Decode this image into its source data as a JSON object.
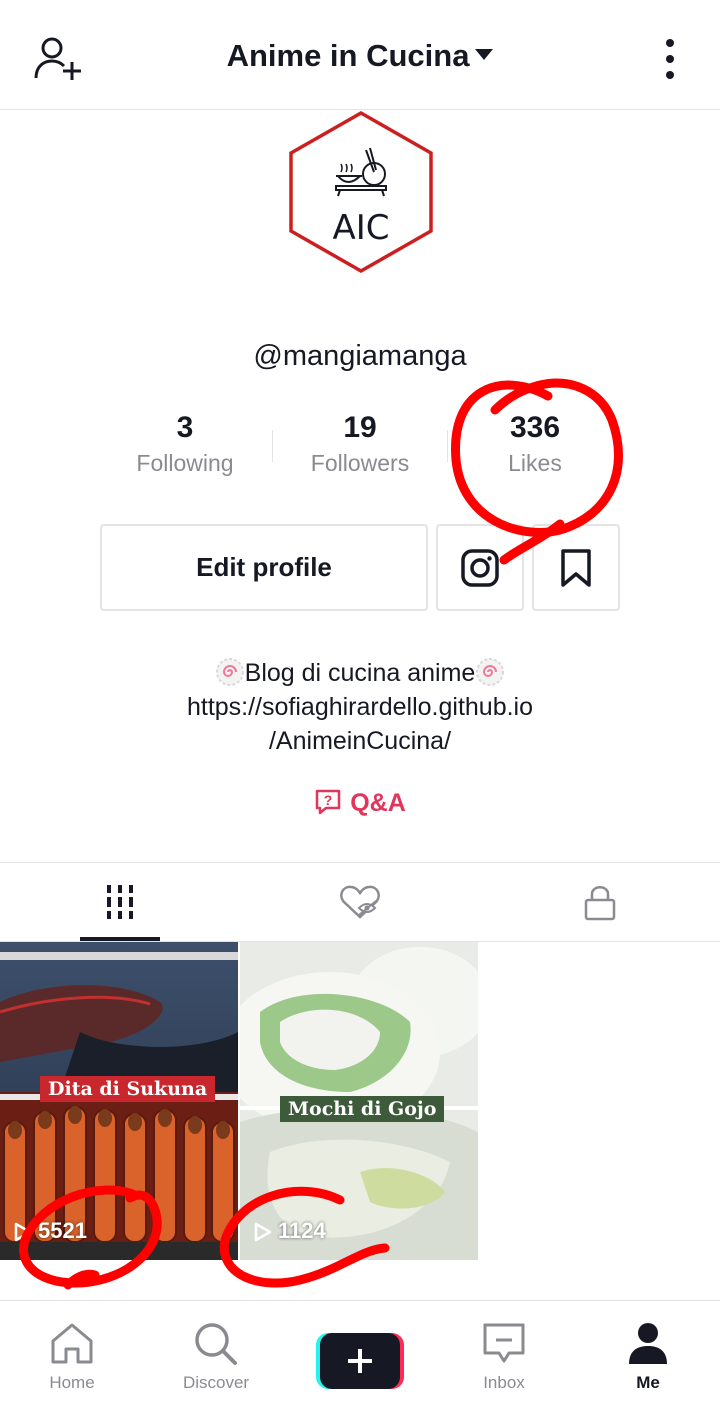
{
  "header": {
    "title": "Anime in Cucina"
  },
  "profile": {
    "avatar_text": "AIC",
    "username": "@mangiamanga"
  },
  "stats": [
    {
      "value": "3",
      "label": "Following"
    },
    {
      "value": "19",
      "label": "Followers"
    },
    {
      "value": "336",
      "label": "Likes"
    }
  ],
  "actions": {
    "edit_label": "Edit profile"
  },
  "bio": {
    "line1": "Blog di cucina anime",
    "line2": "https://sofiaghirardello.github.io",
    "line3": "/AnimeinCucina/"
  },
  "qa": {
    "label": "Q&A"
  },
  "videos": [
    {
      "title": "Dita di Sukuna",
      "views": "5521"
    },
    {
      "title": "Mochi di Gojo",
      "views": "1124"
    }
  ],
  "bottom_nav": [
    {
      "label": "Home",
      "icon": "home-icon"
    },
    {
      "label": "Discover",
      "icon": "search-icon"
    },
    {
      "label": "",
      "icon": "create-icon"
    },
    {
      "label": "Inbox",
      "icon": "inbox-icon"
    },
    {
      "label": "Me",
      "icon": "user-icon"
    }
  ],
  "colors": {
    "accent": "#e2355b",
    "annotation": "#ff0000",
    "avatar_border": "#cc1f1f"
  }
}
